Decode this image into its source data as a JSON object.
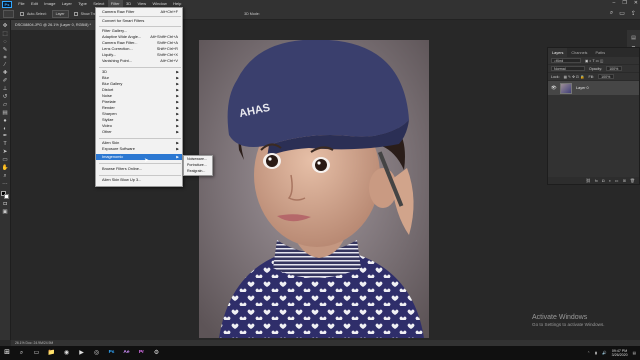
{
  "menubar": {
    "logo": "Ps",
    "items": [
      "File",
      "Edit",
      "Image",
      "Layer",
      "Type",
      "Select",
      "Filter",
      "3D",
      "View",
      "Window",
      "Help"
    ],
    "active_index": 6
  },
  "options_bar": {
    "auto_select": "Auto-Select:",
    "auto_select_value": "Layer",
    "show_transform": "Show Transform Controls",
    "mode_3d": "3D Mode:"
  },
  "document_tab": "DSC08804.JPG @ 26.1% (Layer 0, RGB/8) *",
  "status_bar": "26.1%   Doc: 24.9M/24.9M",
  "filter_menu": {
    "items": [
      {
        "label": "Camera Raw Filter",
        "shortcut": "Alt+Ctrl+F"
      },
      {
        "label": "Convert for Smart Filters"
      },
      {
        "label": "Filter Gallery..."
      },
      {
        "label": "Adaptive Wide Angle...",
        "shortcut": "Alt+Shift+Ctrl+A"
      },
      {
        "label": "Camera Raw Filter...",
        "shortcut": "Shift+Ctrl+A"
      },
      {
        "label": "Lens Correction...",
        "shortcut": "Shift+Ctrl+R"
      },
      {
        "label": "Liquify...",
        "shortcut": "Shift+Ctrl+X"
      },
      {
        "label": "Vanishing Point...",
        "shortcut": "Alt+Ctrl+V"
      },
      {
        "label": "3D",
        "submenu": true
      },
      {
        "label": "Blur",
        "submenu": true
      },
      {
        "label": "Blur Gallery",
        "submenu": true
      },
      {
        "label": "Distort",
        "submenu": true
      },
      {
        "label": "Noise",
        "submenu": true
      },
      {
        "label": "Pixelate",
        "submenu": true
      },
      {
        "label": "Render",
        "submenu": true
      },
      {
        "label": "Sharpen",
        "submenu": true
      },
      {
        "label": "Stylize",
        "submenu": true
      },
      {
        "label": "Video",
        "submenu": true
      },
      {
        "label": "Other",
        "submenu": true
      },
      {
        "label": "Alien Skin",
        "submenu": true
      },
      {
        "label": "Exposure Software",
        "submenu": true
      },
      {
        "label": "Imagenomic",
        "submenu": true,
        "highlighted": true
      },
      {
        "label": "Browse Filters Online..."
      },
      {
        "label": "Alien Skin Blow Up 3..."
      }
    ]
  },
  "submenu": [
    "Noiseware...",
    "Portraiture...",
    "Realgrain..."
  ],
  "layers_panel": {
    "tabs": [
      "Layers",
      "Channels",
      "Paths"
    ],
    "kind_label": "Kind",
    "blend_mode": "Normal",
    "opacity_label": "Opacity:",
    "opacity_value": "100%",
    "lock_label": "Lock:",
    "fill_label": "Fill:",
    "fill_value": "100%",
    "layer_name": "Layer 0"
  },
  "photo_text": "AHAS",
  "watermark": {
    "title": "Activate Windows",
    "subtitle": "Go to Settings to activate Windows."
  },
  "taskbar": {
    "time": "09:47 PM",
    "date": "3/26/2020"
  }
}
